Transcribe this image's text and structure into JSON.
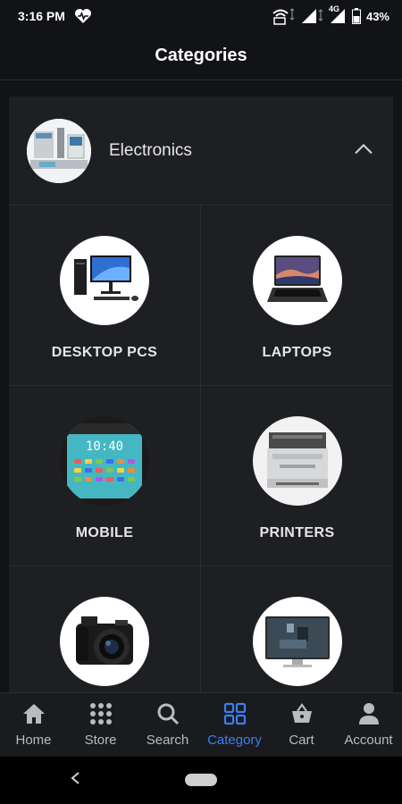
{
  "status_bar": {
    "time": "3:16 PM",
    "network": "4G",
    "battery": "43%"
  },
  "header": {
    "title": "Categories"
  },
  "category_group": {
    "name": "Electronics",
    "items": [
      {
        "label": "DESKTOP PCS",
        "icon": "desktop-pc-image"
      },
      {
        "label": "LAPTOPS",
        "icon": "laptop-image"
      },
      {
        "label": "MOBILE",
        "icon": "mobile-image"
      },
      {
        "label": "PRINTERS",
        "icon": "printer-image"
      },
      {
        "label": "",
        "icon": "camera-image"
      },
      {
        "label": "",
        "icon": "monitor-image"
      }
    ]
  },
  "bottom_nav": [
    {
      "label": "Home",
      "icon": "home-icon"
    },
    {
      "label": "Store",
      "icon": "grid-dots-icon"
    },
    {
      "label": "Search",
      "icon": "search-icon"
    },
    {
      "label": "Category",
      "icon": "category-squares-icon",
      "active": true
    },
    {
      "label": "Cart",
      "icon": "basket-icon"
    },
    {
      "label": "Account",
      "icon": "person-icon"
    }
  ],
  "colors": {
    "accent": "#3d7ef0",
    "background": "#121316",
    "card": "#1d1f22"
  }
}
